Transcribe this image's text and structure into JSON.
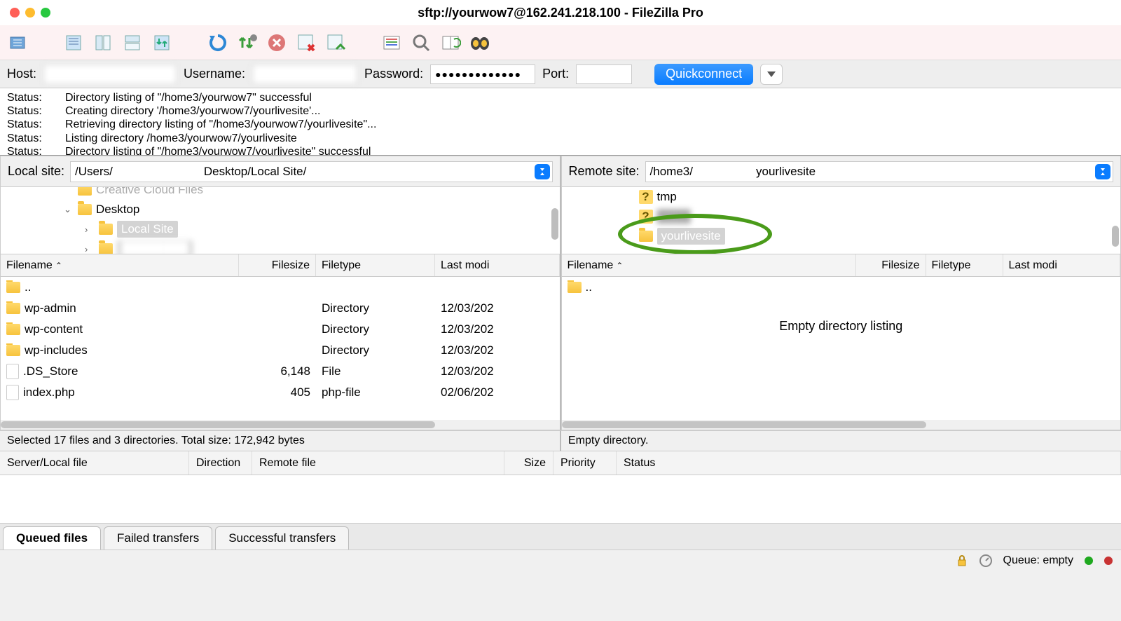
{
  "window": {
    "title": "sftp://yourwow7@162.241.218.100 - FileZilla Pro"
  },
  "connection": {
    "host_label": "Host:",
    "host_value": "",
    "username_label": "Username:",
    "username_value": "",
    "password_label": "Password:",
    "password_mask": "●●●●●●●●●●●●●",
    "port_label": "Port:",
    "port_value": "",
    "quickconnect_label": "Quickconnect"
  },
  "log": [
    {
      "label": "Status:",
      "msg": "Directory listing of \"/home3/yourwow7\" successful"
    },
    {
      "label": "Status:",
      "msg": "Creating directory '/home3/yourwow7/yourlivesite'..."
    },
    {
      "label": "Status:",
      "msg": "Retrieving directory listing of \"/home3/yourwow7/yourlivesite\"..."
    },
    {
      "label": "Status:",
      "msg": "Listing directory /home3/yourwow7/yourlivesite"
    },
    {
      "label": "Status:",
      "msg": "Directory listing of \"/home3/yourwow7/yourlivesite\" successful"
    }
  ],
  "local": {
    "site_label": "Local site:",
    "site_prefix": "/Users/",
    "site_suffix": "Desktop/Local Site/",
    "tree": {
      "top_cut": "Creative Cloud Files",
      "desktop": "Desktop",
      "local_site": "Local Site",
      "blurred_item": "████████"
    },
    "columns": {
      "filename": "Filename",
      "filesize": "Filesize",
      "filetype": "Filetype",
      "modified": "Last modi"
    },
    "rows": [
      {
        "name": "..",
        "size": "",
        "type": "",
        "mod": ""
      },
      {
        "name": "wp-admin",
        "size": "",
        "type": "Directory",
        "mod": "12/03/202"
      },
      {
        "name": "wp-content",
        "size": "",
        "type": "Directory",
        "mod": "12/03/202"
      },
      {
        "name": "wp-includes",
        "size": "",
        "type": "Directory",
        "mod": "12/03/202"
      },
      {
        "name": ".DS_Store",
        "size": "6,148",
        "type": "File",
        "mod": "12/03/202"
      },
      {
        "name": "index.php",
        "size": "405",
        "type": "php-file",
        "mod": "02/06/202"
      }
    ],
    "selection_status": "Selected 17 files and 3 directories. Total size: 172,942 bytes"
  },
  "remote": {
    "site_label": "Remote site:",
    "site_prefix": "/home3/",
    "site_suffix": "yourlivesite",
    "tree": {
      "tmp": "tmp",
      "hidden": "████",
      "yourlivesite": "yourlivesite"
    },
    "columns": {
      "filename": "Filename",
      "filesize": "Filesize",
      "filetype": "Filetype",
      "modified": "Last modi"
    },
    "parent_row": "..",
    "empty_msg": "Empty directory listing",
    "selection_status": "Empty directory."
  },
  "queue_columns": {
    "server": "Server/Local file",
    "direction": "Direction",
    "remote": "Remote file",
    "size": "Size",
    "priority": "Priority",
    "status": "Status"
  },
  "tabs": {
    "queued": "Queued files",
    "failed": "Failed transfers",
    "successful": "Successful transfers"
  },
  "bottom": {
    "queue_label": "Queue: empty"
  }
}
